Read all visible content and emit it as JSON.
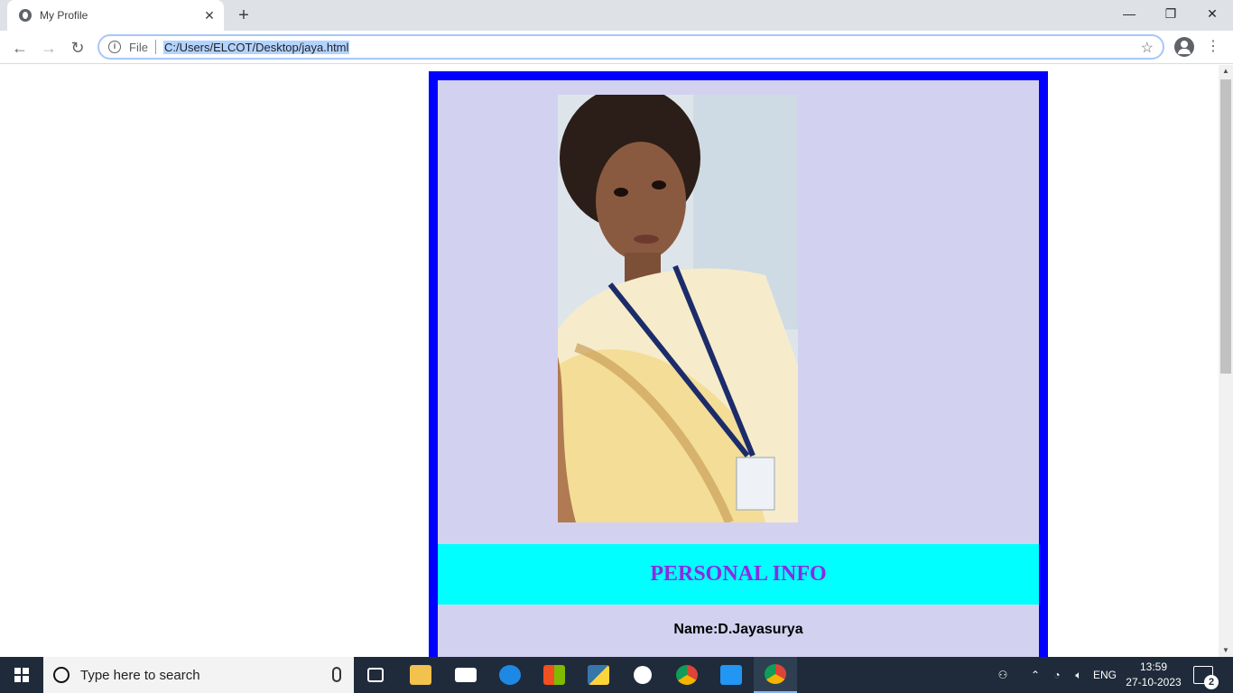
{
  "browser": {
    "tab_title": "My Profile",
    "tab_close": "✕",
    "new_tab": "+",
    "back": "←",
    "forward": "→",
    "reload": "↻",
    "address_scheme": "File",
    "address_url": "C:/Users/ELCOT/Desktop/jaya.html",
    "bookmark_star": "☆",
    "menu": "⋮",
    "window_controls": {
      "minimize": "—",
      "restore": "❐",
      "close": "✕"
    }
  },
  "page": {
    "heading": "PERSONAL INFO",
    "name_line": "Name:D.Jayasurya",
    "colors": {
      "card_border": "#0000ff",
      "card_bg": "#d3d1f0",
      "band_bg": "#00ffff",
      "heading": "#8a2be2"
    }
  },
  "taskbar": {
    "search_placeholder": "Type here to search",
    "pinned": [
      "task-view-icon",
      "file-explorer-icon",
      "mail-icon",
      "edge-icon",
      "store-icon",
      "python-icon",
      "settings-icon",
      "chrome-icon",
      "vscode-icon",
      "chrome-active-icon"
    ],
    "language": "ENG",
    "time": "13:59",
    "date": "27-10-2023",
    "notification_count": "2"
  }
}
